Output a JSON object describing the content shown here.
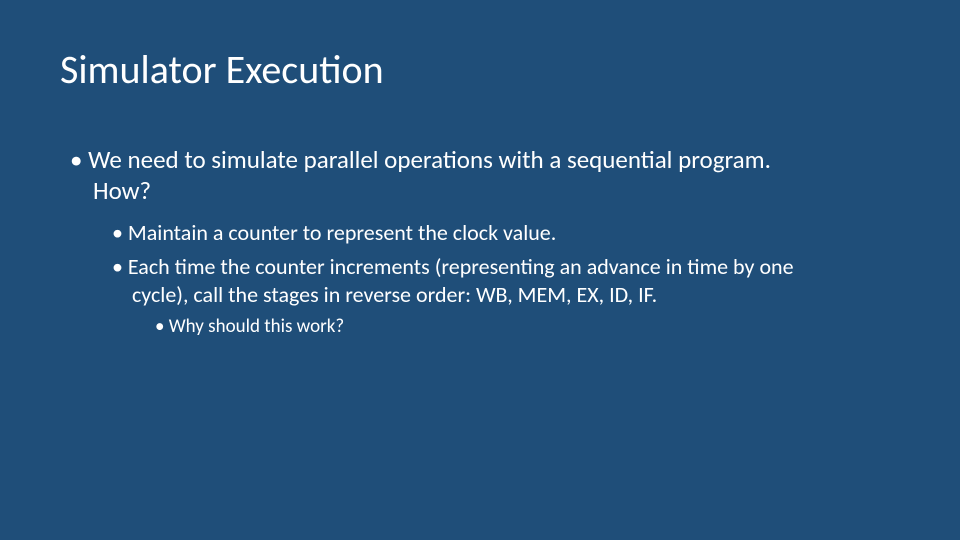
{
  "slide": {
    "title": "Simulator Execution",
    "bullets": {
      "item1_line1": "• We need to simulate parallel operations with a sequential program.",
      "item1_line2": "How?",
      "sub1": "• Maintain a counter to represent the clock value.",
      "sub2_line1": "• Each time the counter increments (representing an advance in time by one",
      "sub2_line2": "cycle), call the stages in reverse order: WB, MEM, EX, ID, IF.",
      "subsub1": "• Why should this work?"
    }
  }
}
